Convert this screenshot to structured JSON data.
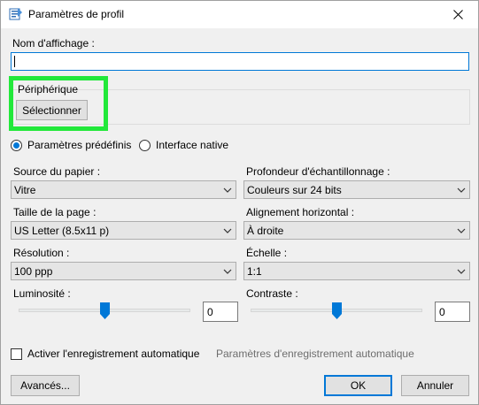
{
  "window": {
    "title": "Paramètres de profil"
  },
  "display_name": {
    "label": "Nom d'affichage :",
    "value": ""
  },
  "device": {
    "group_label": "Périphérique",
    "select_button": "Sélectionner"
  },
  "mode": {
    "predefined_label": "Paramètres prédéfinis",
    "native_label": "Interface native",
    "selected": "predefined"
  },
  "fields": {
    "paper_source": {
      "label": "Source du papier :",
      "value": "Vitre"
    },
    "bit_depth": {
      "label": "Profondeur d'échantillonnage :",
      "value": "Couleurs sur 24 bits"
    },
    "page_size": {
      "label": "Taille de la page :",
      "value": "US Letter (8.5x11 p)"
    },
    "horizontal_align": {
      "label": "Alignement horizontal :",
      "value": "À droite"
    },
    "resolution": {
      "label": "Résolution :",
      "value": "100 ppp"
    },
    "scale": {
      "label": "Échelle :",
      "value": "1:1"
    }
  },
  "brightness": {
    "label": "Luminosité :",
    "value": "0",
    "slider_fraction": 0.5
  },
  "contrast": {
    "label": "Contraste :",
    "value": "0",
    "slider_fraction": 0.5
  },
  "autosave": {
    "checkbox_label": "Activer l'enregistrement automatique",
    "checked": false,
    "settings_link": "Paramètres d'enregistrement automatique"
  },
  "buttons": {
    "advanced": "Avancés...",
    "ok": "OK",
    "cancel": "Annuler"
  },
  "colors": {
    "accent": "#0078d7",
    "highlight": "#22e83a"
  }
}
